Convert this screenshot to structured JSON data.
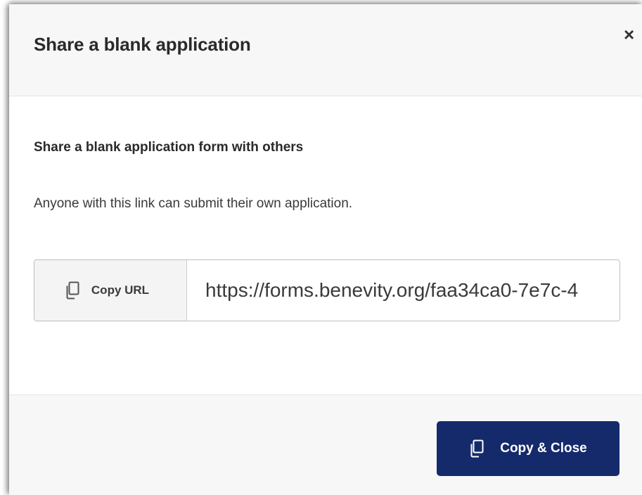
{
  "modal": {
    "title": "Share a blank application",
    "close_label": "×"
  },
  "body": {
    "heading": "Share a blank application form with others",
    "description": "Anyone with this link can submit their own application.",
    "copy_url_label": "Copy URL",
    "url_value": "https://forms.benevity.org/faa34ca0-7e7c-4"
  },
  "footer": {
    "copy_close_label": "Copy & Close"
  },
  "icons": {
    "copy": "copy-icon",
    "close": "close-icon"
  },
  "colors": {
    "primary_button": "#142a6b",
    "header_bg": "#f7f7f7",
    "text": "#2a2a2a"
  }
}
